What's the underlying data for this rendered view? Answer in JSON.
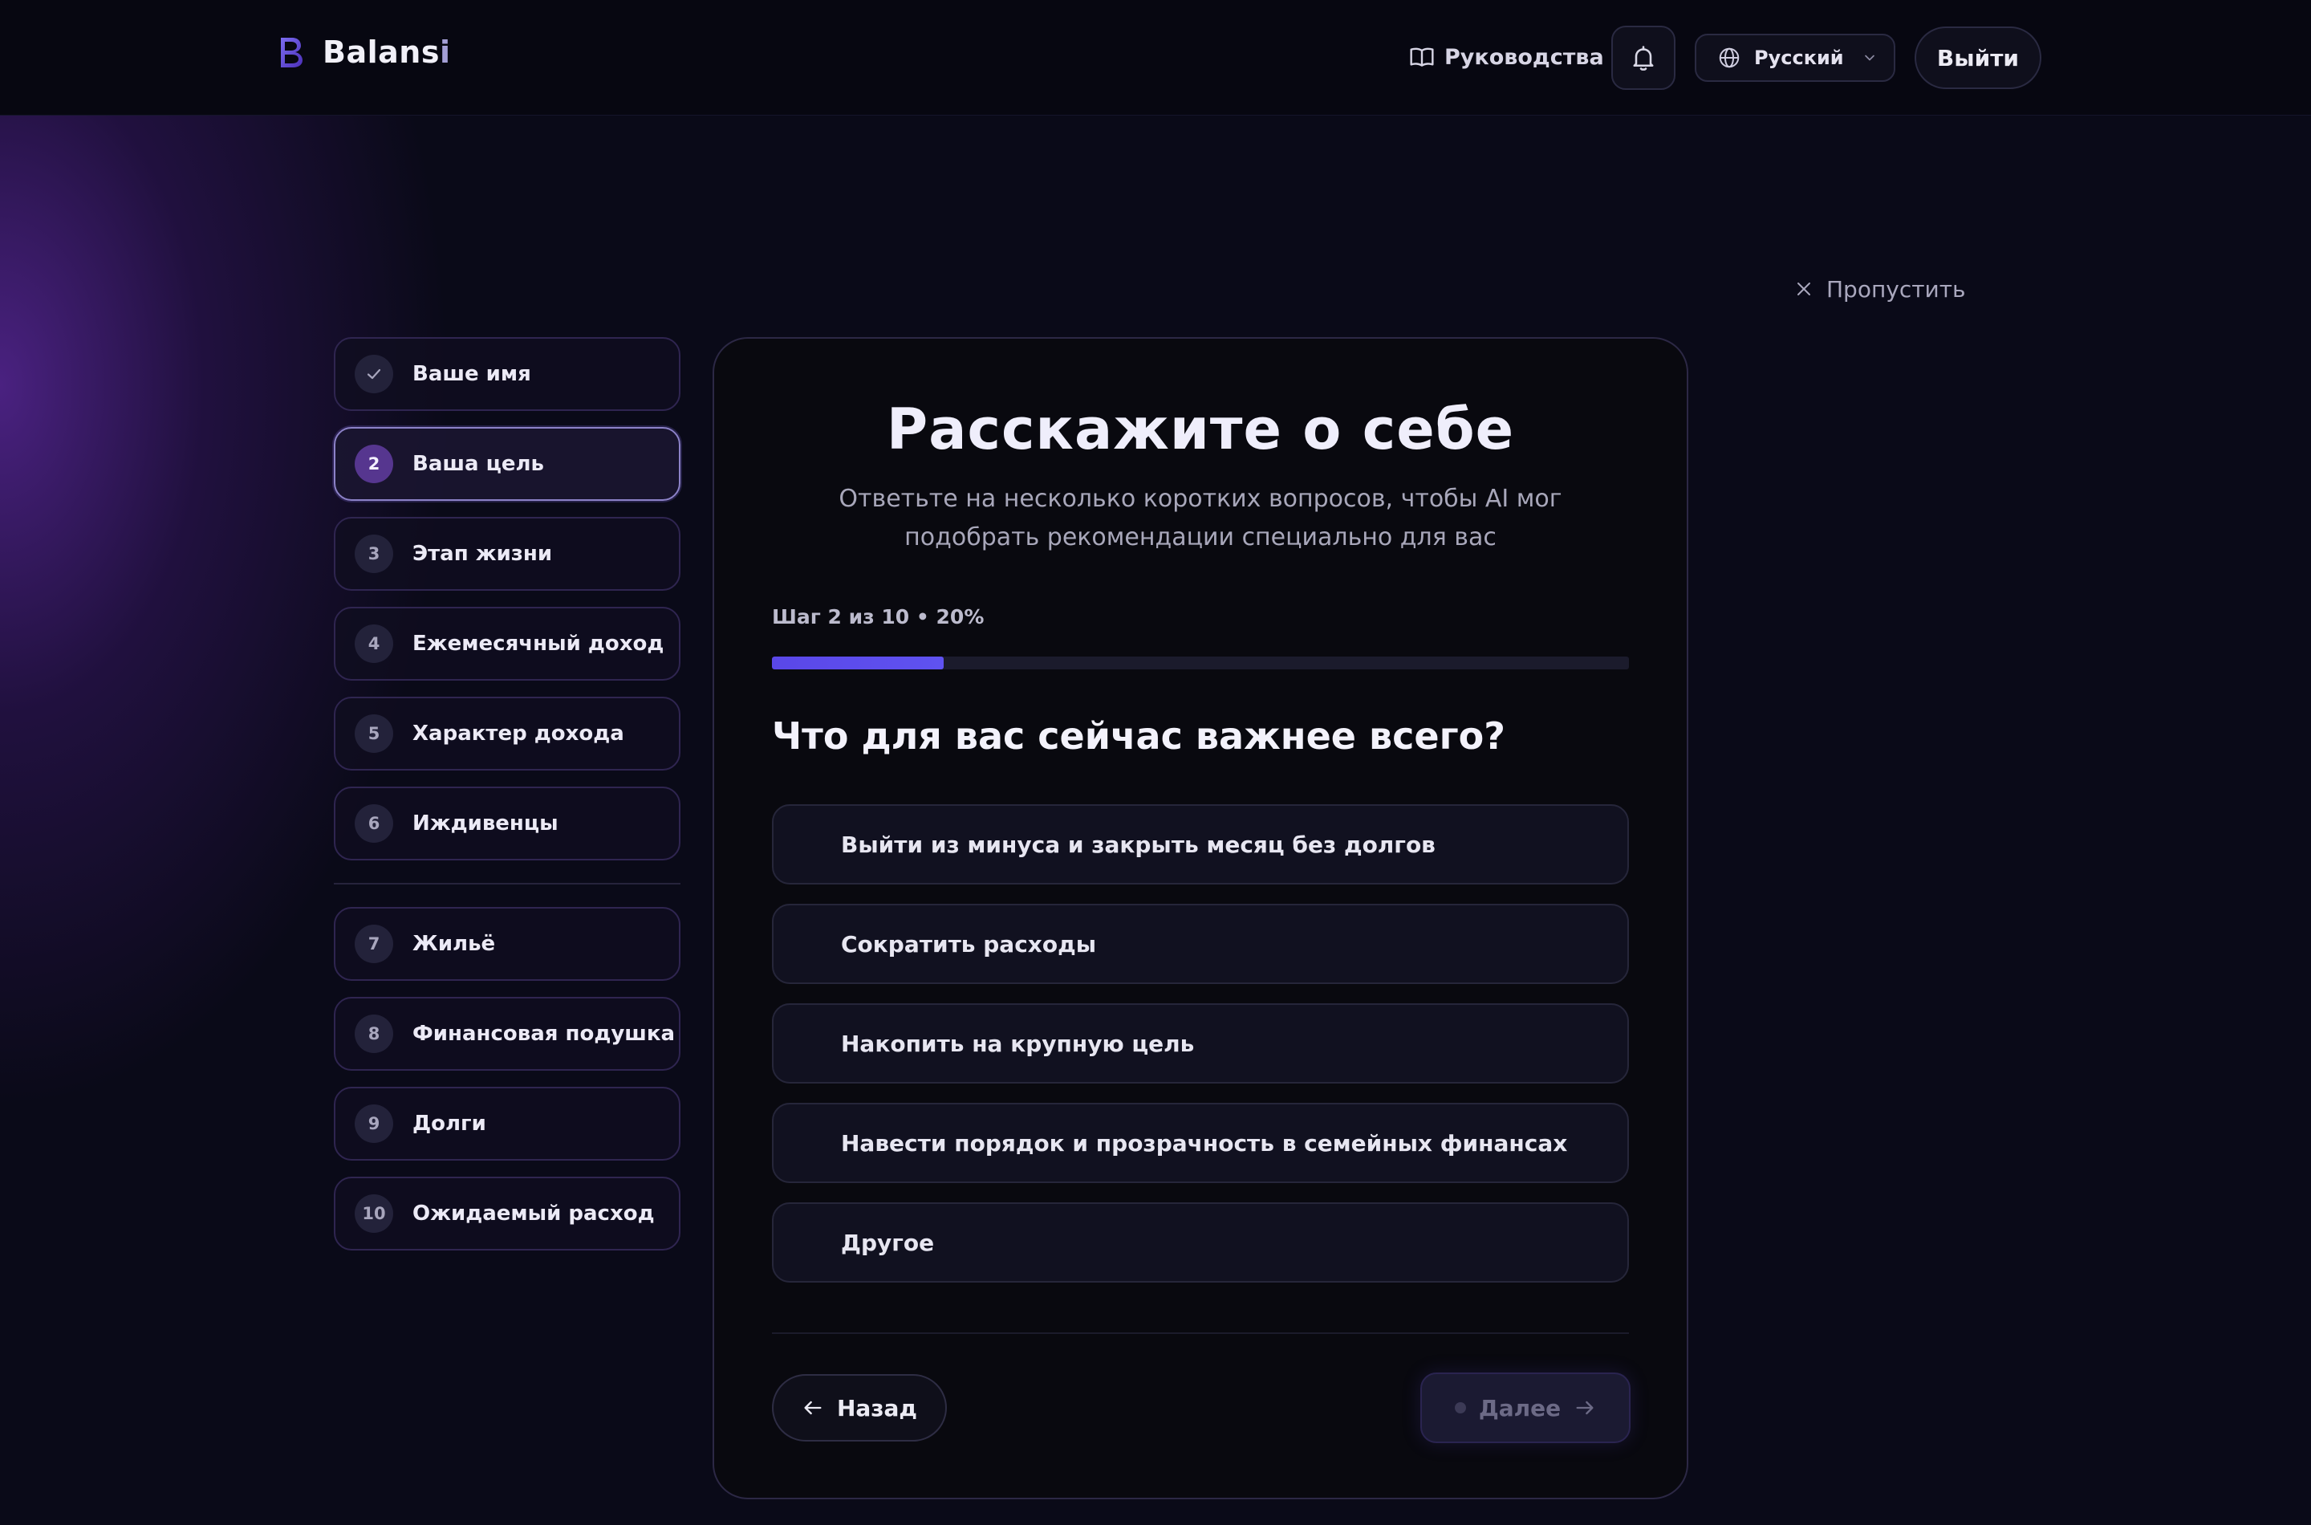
{
  "header": {
    "brand_name": "Balans",
    "brand_name_last": "i",
    "guides_label": "Руководства",
    "language": "Русский",
    "logout_label": "Выйти",
    "icons": [
      "book-icon",
      "bell-icon",
      "globe-icon",
      "chevron-down-icon"
    ]
  },
  "skip_label": "Пропустить",
  "steps": [
    {
      "num": "",
      "label": "Ваше имя",
      "state": "done"
    },
    {
      "num": "2",
      "label": "Ваша цель",
      "state": "active"
    },
    {
      "num": "3",
      "label": "Этап жизни",
      "state": "pending"
    },
    {
      "num": "4",
      "label": "Ежемесячный доход",
      "state": "pending"
    },
    {
      "num": "5",
      "label": "Характер дохода",
      "state": "pending"
    },
    {
      "num": "6",
      "label": "Иждивенцы",
      "state": "pending"
    },
    {
      "num": "7",
      "label": "Жильё",
      "state": "pending"
    },
    {
      "num": "8",
      "label": "Финансовая подушка",
      "state": "pending"
    },
    {
      "num": "9",
      "label": "Долги",
      "state": "pending"
    },
    {
      "num": "10",
      "label": "Ожидаемый расход",
      "state": "pending"
    }
  ],
  "card": {
    "title": "Расскажите о себе",
    "subtitle": "Ответьте на несколько коротких вопросов, чтобы AI мог подобрать рекомендации специально для вас",
    "progress_label": "Шаг 2 из 10 • 20%",
    "progress_fraction": 0.2,
    "question": "Что для вас сейчас важнее всего?",
    "options": [
      "Выйти из минуса и закрыть месяц без долгов",
      "Сократить расходы",
      "Накопить на крупную цель",
      "Навести порядок и прозрачность в семейных финансах",
      "Другое"
    ],
    "back_label": "Назад",
    "next_label": "Далее"
  },
  "colors": {
    "accent": "#5a47e8",
    "active_step": "#56368f",
    "background": "#0a0a18"
  }
}
